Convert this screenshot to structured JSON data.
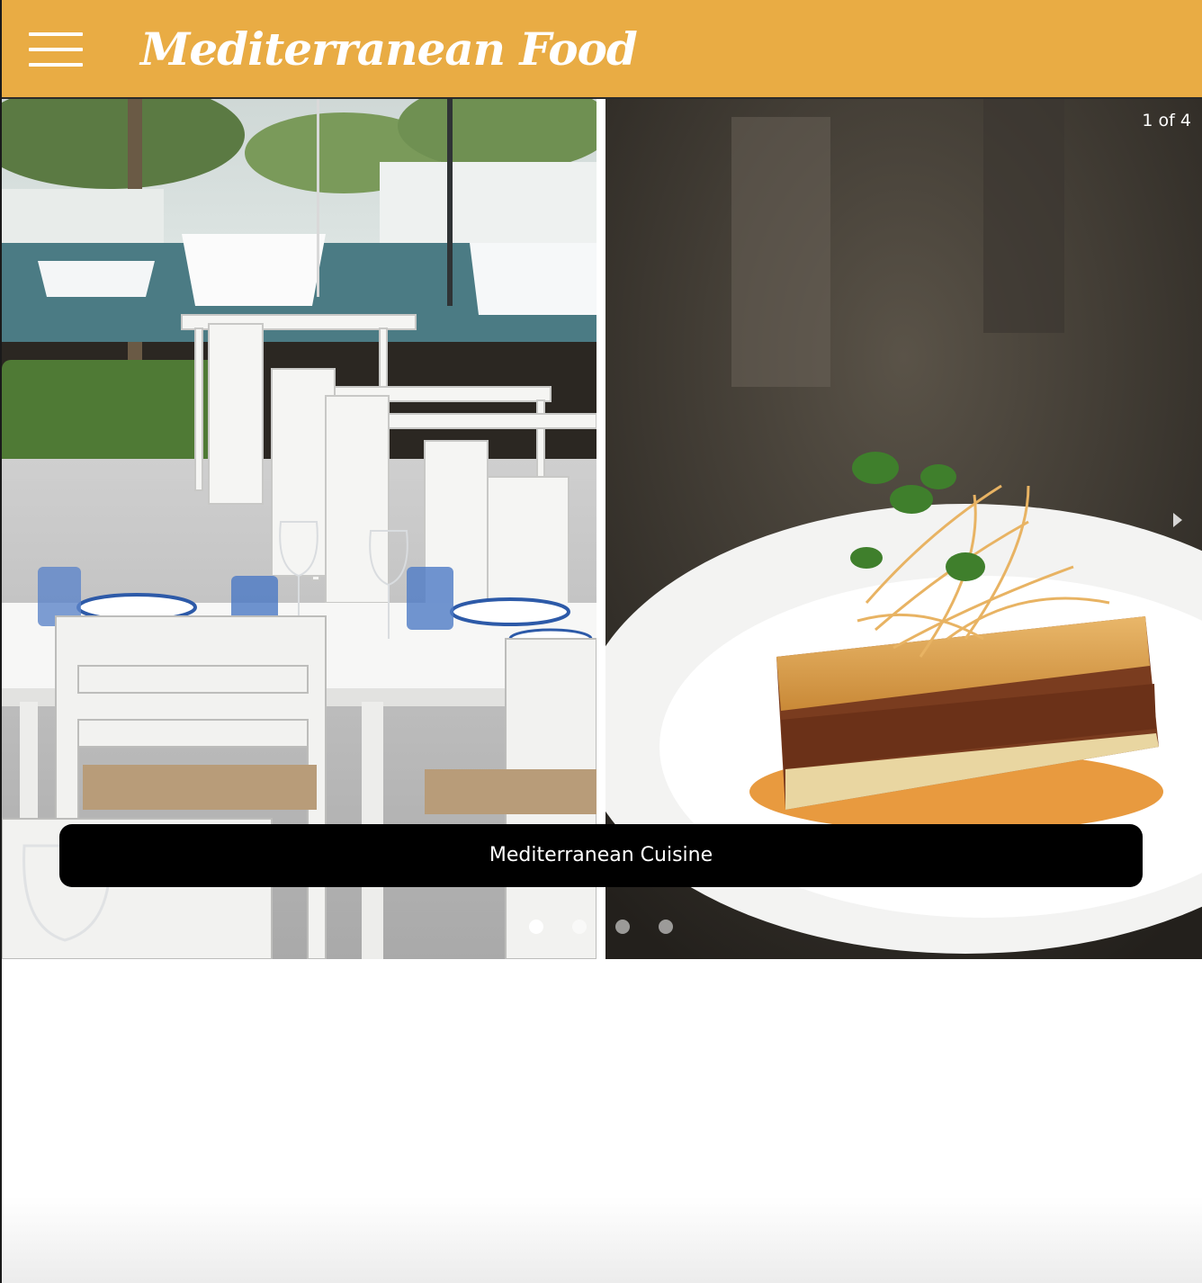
{
  "header": {
    "title": "Mediterranean Food",
    "background_color": "#e9ac44",
    "menu_icon": "hamburger-menu-icon"
  },
  "slideshow": {
    "counter": "1 of 4",
    "caption": "Mediterranean Cuisine",
    "slide_count": 4,
    "active_index": 0,
    "images": [
      "outdoor-marina-restaurant-tables-photo",
      "moussaka-dish-photo"
    ]
  }
}
